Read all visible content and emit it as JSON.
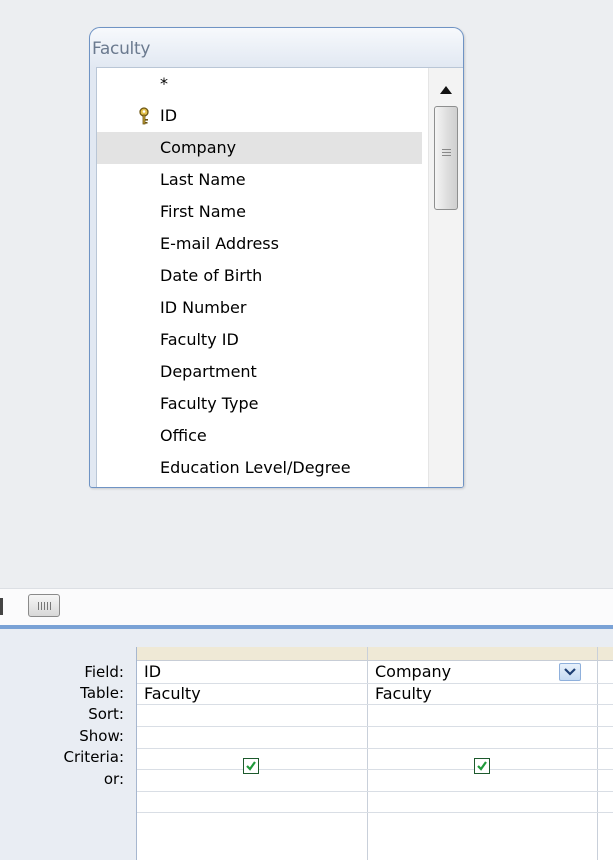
{
  "table_window": {
    "title": "Faculty",
    "fields": [
      {
        "label": "*",
        "is_key": false,
        "selected": false
      },
      {
        "label": "ID",
        "is_key": true,
        "selected": false
      },
      {
        "label": "Company",
        "is_key": false,
        "selected": true
      },
      {
        "label": "Last Name",
        "is_key": false,
        "selected": false
      },
      {
        "label": "First Name",
        "is_key": false,
        "selected": false
      },
      {
        "label": "E-mail Address",
        "is_key": false,
        "selected": false
      },
      {
        "label": "Date of Birth",
        "is_key": false,
        "selected": false
      },
      {
        "label": "ID Number",
        "is_key": false,
        "selected": false
      },
      {
        "label": "Faculty ID",
        "is_key": false,
        "selected": false
      },
      {
        "label": "Department",
        "is_key": false,
        "selected": false
      },
      {
        "label": "Faculty Type",
        "is_key": false,
        "selected": false
      },
      {
        "label": "Office",
        "is_key": false,
        "selected": false
      },
      {
        "label": "Education Level/Degree",
        "is_key": false,
        "selected": false
      }
    ]
  },
  "grid": {
    "row_labels": {
      "field": "Field:",
      "table": "Table:",
      "sort": "Sort:",
      "show": "Show:",
      "criteria": "Criteria:",
      "or": "or:"
    },
    "columns": [
      {
        "field": "ID",
        "table": "Faculty",
        "show": true
      },
      {
        "field": "Company",
        "table": "Faculty",
        "show": true
      }
    ]
  },
  "colors": {
    "accent_border": "#6f93c4",
    "selection": "#e3e3e3",
    "checkbox_check": "#1f9a3a"
  },
  "icons": {
    "key": "key-icon",
    "scroll_up": "arrow-up-icon",
    "scroll_down": "arrow-down-icon",
    "dropdown": "chevron-down-icon",
    "check": "checkmark-icon"
  }
}
